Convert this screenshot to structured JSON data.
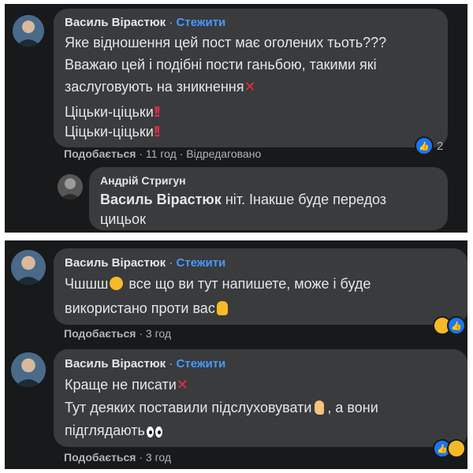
{
  "top_panel": {
    "comment1": {
      "author": "Василь Вірастюк",
      "separator": "·",
      "follow": "Стежити",
      "lines": [
        "Яке відношення цей пост має оголених тьоть???",
        "Вважаю цей і подібні пости ганьбою, такими які",
        "заслуговують на зникнення"
      ],
      "line4": "Ціцьки-ціцьки",
      "line5": "Ціцьки-ціцьки",
      "like_label": "Подобається",
      "time": "11 год",
      "edited": "Відредаговано",
      "reaction_count": "2"
    },
    "reply": {
      "author": "Андрій Стригун",
      "mention": "Василь Вірастюк",
      "text1": " ніт. Інакше буде передоз",
      "text2": "цицьок"
    }
  },
  "bottom_panel": {
    "comment2": {
      "author": "Василь Вірастюк",
      "separator": "·",
      "follow": "Стежити",
      "line1a": "Чшшш",
      "line1b": " все що ви тут напишете, може і буде",
      "line2": "використано проти вас",
      "like_label": "Подобається",
      "time": "3 год"
    },
    "comment3": {
      "author": "Василь Вірастюк",
      "separator": "·",
      "follow": "Стежити",
      "line1": "Краще не писати",
      "line2a": "Тут деяких поставили підслуховувати",
      "line2b": ", а вони",
      "line3": "підглядають",
      "like_label": "Подобається",
      "time": "3 год"
    }
  },
  "symbols": {
    "cross": "✕",
    "double_bang": "!!",
    "dot": "·",
    "like": "👍"
  },
  "colors": {
    "panel_bg": "#18191a",
    "bubble_bg": "#3a3b3c",
    "text": "#e4e6eb",
    "muted": "#b0b3b8",
    "follow": "#4599ff",
    "like_blue": "#1877f2",
    "haha_yellow": "#f7b928",
    "red": "#f02849"
  }
}
